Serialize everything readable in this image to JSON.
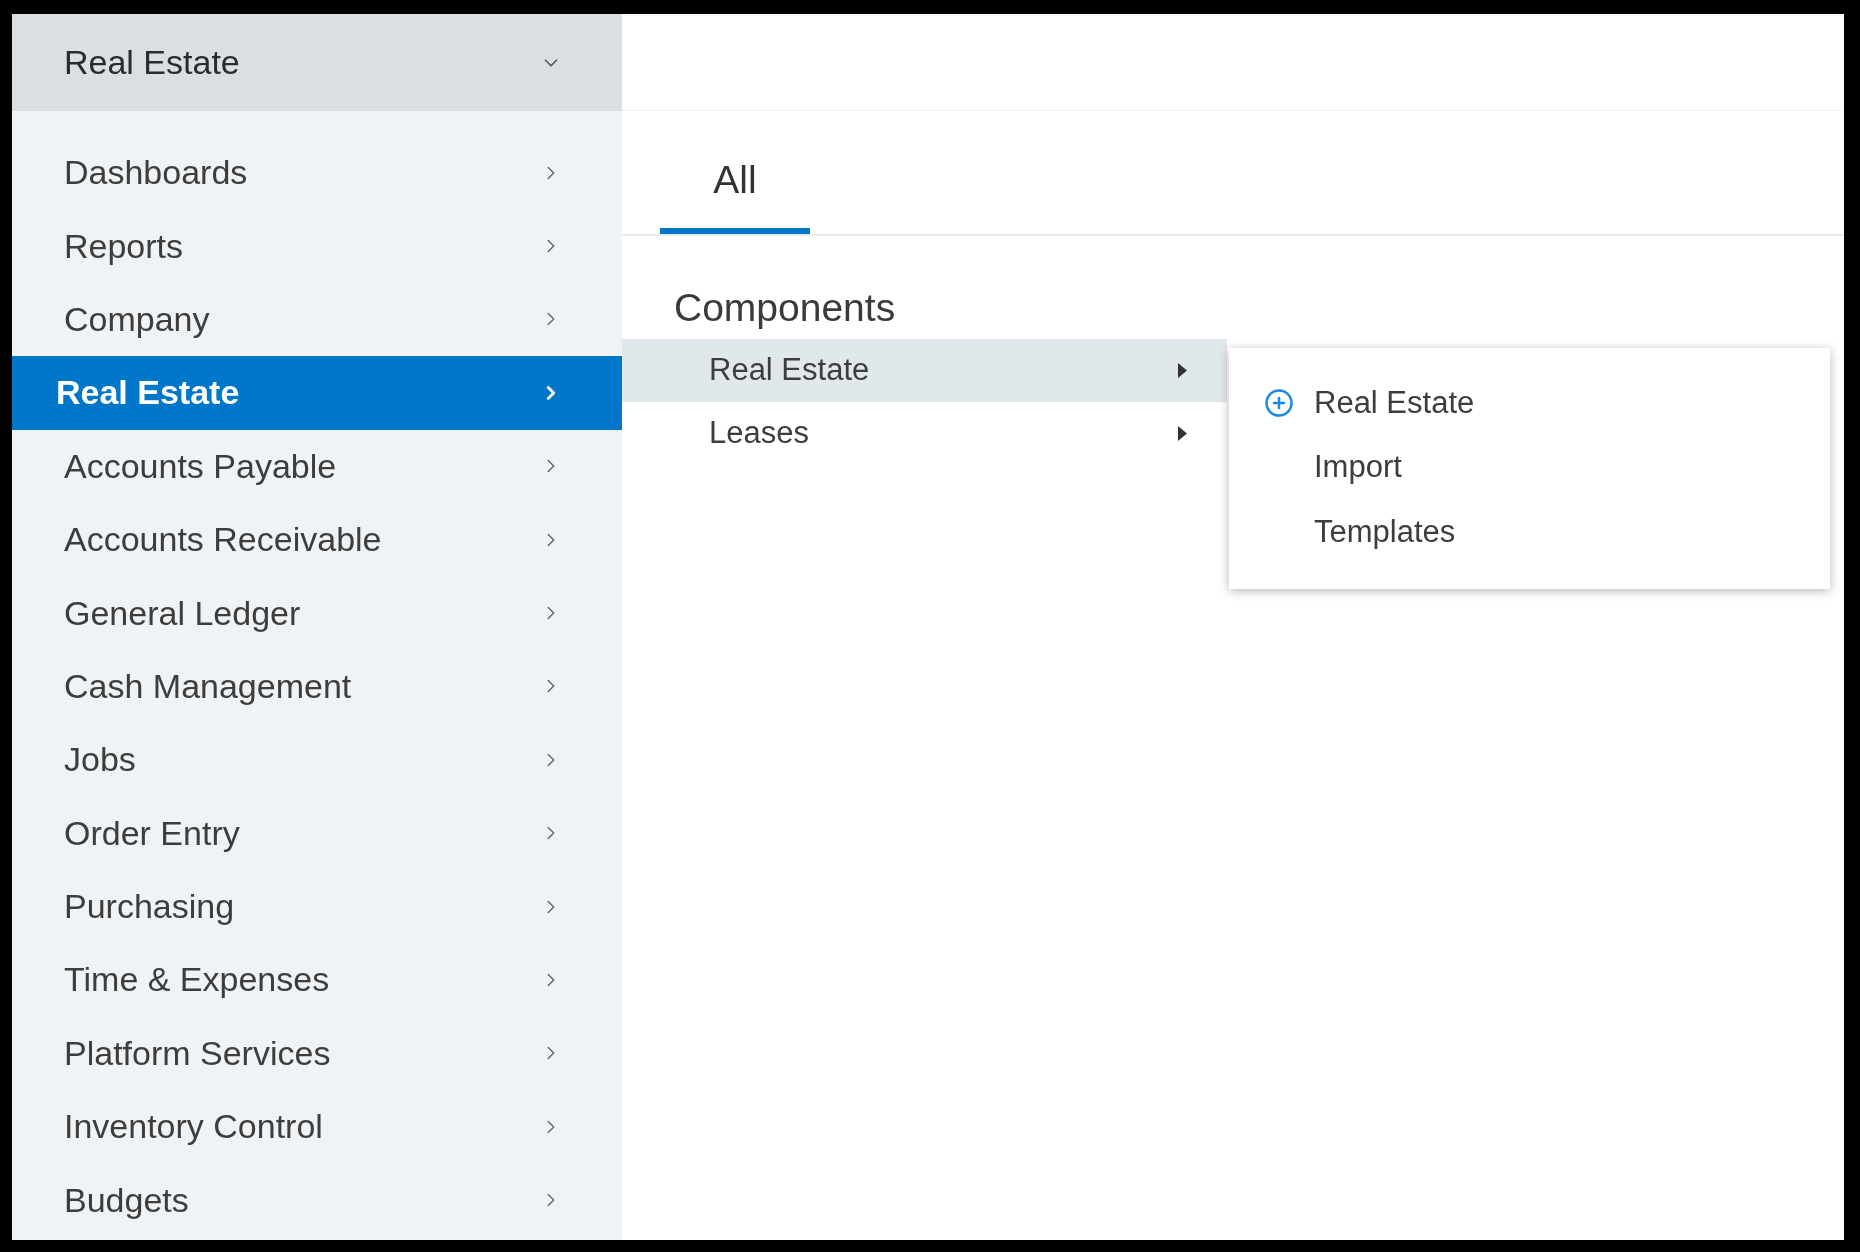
{
  "sidebar": {
    "module_selector": {
      "label": "Real Estate"
    },
    "items": [
      {
        "label": "Dashboards",
        "selected": false
      },
      {
        "label": "Reports",
        "selected": false
      },
      {
        "label": "Company",
        "selected": false
      },
      {
        "label": "Real Estate",
        "selected": true
      },
      {
        "label": "Accounts Payable",
        "selected": false
      },
      {
        "label": "Accounts Receivable",
        "selected": false
      },
      {
        "label": "General Ledger",
        "selected": false
      },
      {
        "label": "Cash Management",
        "selected": false
      },
      {
        "label": "Jobs",
        "selected": false
      },
      {
        "label": "Order Entry",
        "selected": false
      },
      {
        "label": "Purchasing",
        "selected": false
      },
      {
        "label": "Time & Expenses",
        "selected": false
      },
      {
        "label": "Platform Services",
        "selected": false
      },
      {
        "label": "Inventory Control",
        "selected": false
      },
      {
        "label": "Budgets",
        "selected": false
      }
    ]
  },
  "tabs": [
    {
      "label": "All",
      "selected": true
    }
  ],
  "components": {
    "heading": "Components",
    "items": [
      {
        "label": "Real Estate",
        "selected": true
      },
      {
        "label": "Leases",
        "selected": false
      }
    ]
  },
  "flyout_menu": {
    "items": [
      {
        "label": "Real Estate",
        "kind": "add"
      },
      {
        "label": "Import",
        "kind": "plain"
      },
      {
        "label": "Templates",
        "kind": "plain"
      }
    ]
  }
}
